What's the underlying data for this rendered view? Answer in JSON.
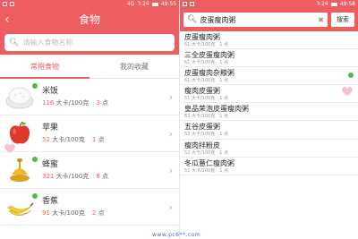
{
  "left": {
    "status": {
      "carrier": "4G",
      "time": "3:24",
      "right_time": "49:55"
    },
    "title": "食物",
    "search_placeholder": "请输入食物名称",
    "tabs": [
      {
        "label": "常用食物",
        "active": true
      },
      {
        "label": "我的收藏",
        "active": false
      }
    ],
    "foods": [
      {
        "name": "米饭",
        "kcal": "116",
        "unit": "大卡/100克",
        "points": "3",
        "points_label": "点"
      },
      {
        "name": "苹果",
        "kcal": "52",
        "unit": "大卡/100克",
        "points": "1",
        "points_label": "点"
      },
      {
        "name": "蜂蜜",
        "kcal": "321",
        "unit": "大卡/100克",
        "points": "8",
        "points_label": "点"
      },
      {
        "name": "香蕉",
        "kcal": "91",
        "unit": "大卡/100克",
        "points": "2",
        "points_label": "点"
      }
    ]
  },
  "right": {
    "status": {
      "time": "3:24",
      "right_time": "49:58"
    },
    "search_value": "皮蛋瘦肉粥",
    "search_button": "搜索",
    "results": [
      {
        "name": "皮蛋瘦肉粥",
        "kcal": "61",
        "unit": "大卡/100克",
        "points": "1",
        "points_label": "点",
        "dot": false
      },
      {
        "name": "三全皮蛋瘦肉粥",
        "kcal": "61",
        "unit": "大卡/100克",
        "points": "1",
        "points_label": "点",
        "dot": false
      },
      {
        "name": "皮蛋瘦肉杂粮粥",
        "kcal": "61",
        "unit": "大卡/100克",
        "points": "1",
        "points_label": "点",
        "dot": true
      },
      {
        "name": "瘦肉皮蛋粥",
        "kcal": "51",
        "unit": "大卡/100克",
        "points": "1",
        "points_label": "点",
        "dot": false
      },
      {
        "name": "皇品荣泡皮蛋瘦肉粥",
        "kcal": "63",
        "unit": "大卡/100克",
        "points": "1",
        "points_label": "点",
        "dot": false
      },
      {
        "name": "五谷皮蛋粥",
        "kcal": "53",
        "unit": "大卡/100克",
        "points": "1",
        "points_label": "点",
        "dot": false
      },
      {
        "name": "瘦肉拌粉皮",
        "kcal": "52",
        "unit": "大卡/100克",
        "points": "1",
        "points_label": "点",
        "dot": false
      },
      {
        "name": "冬瓜薏仁瘦肉粥",
        "kcal": "51",
        "unit": "大卡/100克",
        "points": "1",
        "points_label": "点",
        "dot": false
      }
    ]
  },
  "watermark": "www.pc6**.com",
  "colors": {
    "accent": "#ee5d5f",
    "green_dot": "#4cba4c"
  }
}
